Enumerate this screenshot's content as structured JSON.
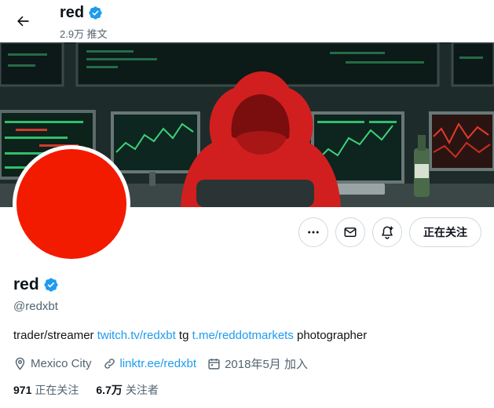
{
  "header": {
    "name": "red",
    "post_count": "2.9万 推文"
  },
  "colors": {
    "avatar": "#f21b00",
    "verified": "#1d9bf0",
    "link": "#1d9bf0"
  },
  "profile": {
    "name": "red",
    "handle": "@redxbt",
    "bio": {
      "text1": "trader/streamer ",
      "link1": "twitch.tv/redxbt",
      "text2": " tg ",
      "link2": "t.me/reddotmarkets",
      "text3": " photographer"
    },
    "location": "Mexico City",
    "website": "linktr.ee/redxbt",
    "joined": "2018年5月 加入"
  },
  "actions": {
    "more_icon": "more-icon",
    "message_icon": "envelope-icon",
    "notify_icon": "bell-plus-icon",
    "follow_label": "正在关注"
  },
  "stats": {
    "following_count": "971",
    "following_label": "正在关注",
    "followers_count": "6.7万",
    "followers_label": "关注者"
  }
}
